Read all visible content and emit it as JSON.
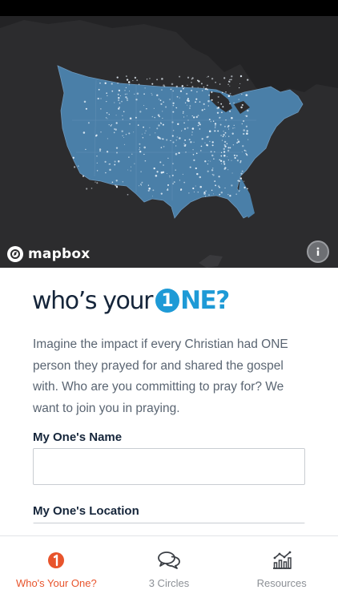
{
  "map": {
    "attribution_logo": "mapbox",
    "info_icon": "info-icon",
    "land_color": "#4a7fa8",
    "background_color": "#2c2c2e"
  },
  "brand": {
    "prefix": "who’s your",
    "one_digit": "1",
    "suffix": "NE?",
    "accent_color": "#1e9ad6"
  },
  "intro": {
    "text": "Imagine the impact if every Christian had ONE person they prayed for and shared the gospel with. Who are you committing to pray for? We want to join you in praying."
  },
  "form": {
    "name_label": "My One's Name",
    "name_value": "",
    "location_label": "My One's Location",
    "location_value": ""
  },
  "tabs": [
    {
      "label": "Who's Your One?",
      "icon": "one-badge-icon",
      "active": true
    },
    {
      "label": "3 Circles",
      "icon": "chat-bubbles-icon",
      "active": false
    },
    {
      "label": "Resources",
      "icon": "chart-icon",
      "active": false
    }
  ]
}
